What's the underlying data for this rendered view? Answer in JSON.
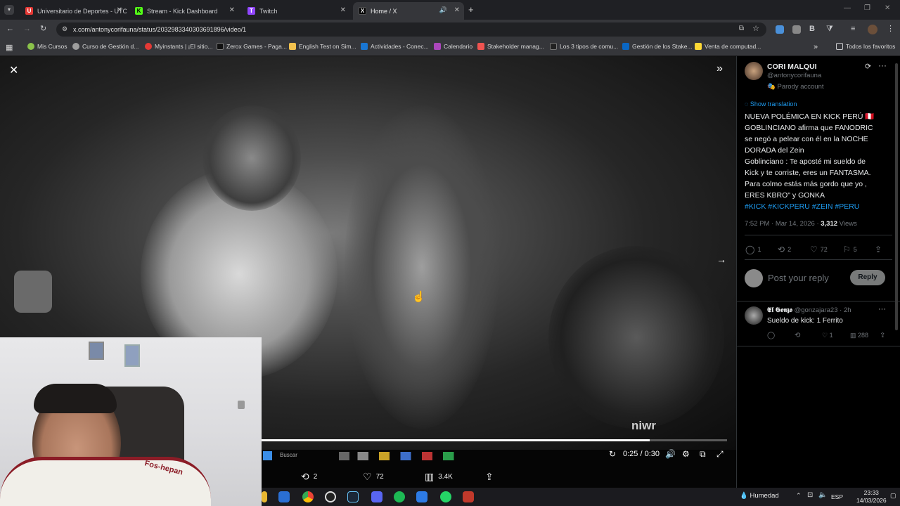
{
  "tabs": [
    {
      "label": "Universitario de Deportes - UTC",
      "color": "#e53935",
      "glyph": "U"
    },
    {
      "label": "Stream - Kick Dashboard",
      "color": "#53fc18",
      "glyph": "K"
    },
    {
      "label": "Twitch",
      "color": "#9146ff",
      "glyph": "T"
    },
    {
      "label": "Home / X",
      "color": "#000000",
      "glyph": "X"
    }
  ],
  "address": {
    "url": "x.com/antonycorifauna/status/2032983340303691896/video/1"
  },
  "bookmarks": [
    {
      "label": "Mis Cursos",
      "color": "#8bc34a"
    },
    {
      "label": "Curso de Gestión d...",
      "color": "#9e9e9e"
    },
    {
      "label": "Myinstants | ¡El sitio...",
      "color": "#e53935"
    },
    {
      "label": "Zerox Games - Paga...",
      "color": "#111111"
    },
    {
      "label": "English Test on Sim...",
      "color": "#f2c14e"
    },
    {
      "label": "Actividades - Conec...",
      "color": "#1976d2"
    },
    {
      "label": "Calendario",
      "color": "#ab47bc"
    },
    {
      "label": "Stakeholder manag...",
      "color": "#ef5350"
    },
    {
      "label": "Los 3 tipos de comu...",
      "color": "#212121"
    },
    {
      "label": "Gestión de los Stake...",
      "color": "#0a66c2"
    },
    {
      "label": "Venta de computad...",
      "color": "#fdd835"
    },
    {
      "label": "Todos los favoritos",
      "color": "#c8c9cc"
    }
  ],
  "video": {
    "progress": 0.8333,
    "time": "0:25 / 0:30",
    "actions": {
      "retweets": "2",
      "likes": "72",
      "views": "3.4K"
    },
    "watermark": "niwr"
  },
  "tweet": {
    "name": "CORI MALQUI",
    "handle": "@antonycorifauna",
    "badge": "Parody account",
    "translate": "Show translation",
    "lines": [
      "NUEVA POLÉMICA EN KICK PERÚ 🇵🇪",
      "GOBLINCIANO afirma que FANODRIC",
      "se negó a pelear con él en la NOCHE",
      "DORADA del Zein",
      "Goblinciano : Te aposté mi sueldo de",
      "Kick y te corriste, eres un FANTASMA.",
      "Para colmo estás más gordo que yo ,",
      "ERES KBRO\" y GONKA"
    ],
    "hashtags": "#KICK #KICKPERU #ZEIN #PERU",
    "meta_time": "7:52 PM · Mar 14, 2026 · ",
    "meta_views": "3,312",
    "meta_views_label": " Views",
    "stats": {
      "replies": "1",
      "retweets": "2",
      "likes": "72",
      "bookmarks": "5"
    },
    "reply_placeholder": "Post your reply",
    "reply_button": "Reply"
  },
  "comment": {
    "name": "𝕰𝖑 𝕲𝖔𝖓𝖟𝖔",
    "handle": "@gonzajara23 · 2h",
    "text": "Sueldo de kick: 1 Ferrito",
    "likes": "1",
    "views": "288"
  },
  "taskbar": {
    "weather": "Humedad",
    "lang": "ESP",
    "time": "23:33",
    "date": "14/03/2026",
    "search": "Buscar"
  }
}
